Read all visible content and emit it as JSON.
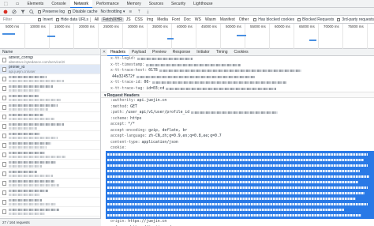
{
  "tabs": {
    "items": [
      "Elements",
      "Console",
      "Network",
      "Performance",
      "Memory",
      "Sources",
      "Security",
      "Lighthouse"
    ],
    "active": "Network"
  },
  "toolbar": {
    "preserve_log": "Preserve log",
    "disable_cache": "Disable cache",
    "throttling": "No throttling"
  },
  "filterbar": {
    "filter_label": "Filter",
    "invert": "Invert",
    "hide_data_urls": "Hide data URLs",
    "types": [
      "All",
      "Fetch/XHR",
      "JS",
      "CSS",
      "Img",
      "Media",
      "Font",
      "Doc",
      "WS",
      "Wasm",
      "Manifest",
      "Other"
    ],
    "active_type": "Fetch/XHR",
    "blocked_cookies": "Has blocked cookies",
    "blocked_requests": "Blocked Requests",
    "third_party": "3rd-party requests"
  },
  "timeline": {
    "ticks": [
      "5000 ms",
      "10000 ms",
      "15000 ms",
      "20000 ms",
      "25000 ms",
      "30000 ms",
      "35000 ms",
      "40000 ms",
      "45000 ms",
      "50000 ms",
      "55000 ms",
      "60000 ms",
      "65000 ms",
      "70000 ms",
      "75000 ms"
    ]
  },
  "requests": {
    "column_name": "Name",
    "items": [
      {
        "name": "abtest_config/",
        "sub": "abtestsvc.bytedance.com/service/2/"
      },
      {
        "name": "profile_id",
        "sub": "api.juejin.cn/user",
        "selected": true
      }
    ],
    "status": "27 / 164 requests"
  },
  "details": {
    "tabs": [
      "Headers",
      "Payload",
      "Preview",
      "Response",
      "Initiator",
      "Timing",
      "Cookies"
    ],
    "active_tab": "Headers",
    "response_headers": [
      {
        "k": "x-tt-logid:"
      },
      {
        "k": "x-tt-timestamp:"
      },
      {
        "k": "x-tt-trace-host:",
        "v": "0178"
      },
      {
        "k": "",
        "v": "44a324572f"
      },
      {
        "k": "x-tt-trace-id:",
        "v": "00-"
      },
      {
        "k": "x-tt-trace-tag:",
        "v": "id=03;cd"
      }
    ],
    "request_section": "Request Headers",
    "request_headers": [
      {
        "k": ":authority:",
        "v": "api.juejin.cn"
      },
      {
        "k": ":method:",
        "v": "GET"
      },
      {
        "k": ":path:",
        "v": "/user_api/v1/user/profile_id"
      },
      {
        "k": ":scheme:",
        "v": "https"
      },
      {
        "k": "accept:",
        "v": "*/*"
      },
      {
        "k": "accept-encoding:",
        "v": "gzip, deflate, br"
      },
      {
        "k": "accept-language:",
        "v": "zh-CN,zh;q=0.9,en;q=0.8,ee;q=0.7"
      },
      {
        "k": "content-type:",
        "v": "application/json"
      }
    ],
    "cookie_key": "cookie:",
    "after_cookie": [
      {
        "k": "origin:",
        "v": "https://juejin.cn"
      },
      {
        "k": "referer:",
        "v": "https://juejin.cn/"
      }
    ]
  }
}
